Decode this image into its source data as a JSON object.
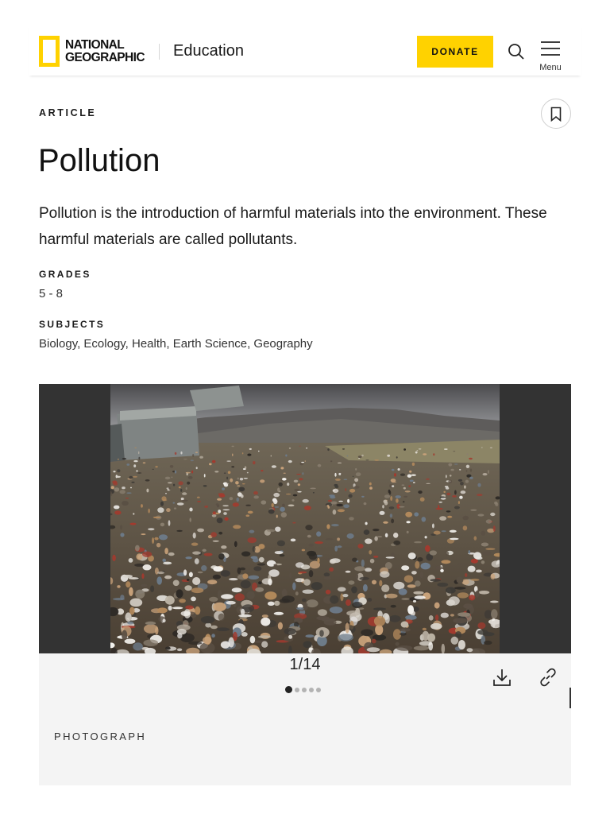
{
  "header": {
    "logo_line1": "NATIONAL",
    "logo_line2": "GEOGRAPHIC",
    "section_label": "Education",
    "donate_label": "DONATE",
    "menu_label": "Menu",
    "brand_color": "#FFD200"
  },
  "article": {
    "type_label": "ARTICLE",
    "title": "Pollution",
    "lede": "Pollution is the introduction of harmful materials into the environment. These harmful materials are called pollutants.",
    "grades_label": "GRADES",
    "grades_value": "5 - 8",
    "subjects_label": "SUBJECTS",
    "subjects_value": "Biology, Ecology, Health, Earth Science, Geography"
  },
  "gallery": {
    "counter": "1/14",
    "current_index": 1,
    "total": 14,
    "visible_dots": 5,
    "media_type_label": "PHOTOGRAPH"
  },
  "icons": {
    "search": "search-icon",
    "menu": "hamburger-icon",
    "bookmark": "bookmark-icon",
    "download": "download-icon",
    "link": "link-icon"
  }
}
